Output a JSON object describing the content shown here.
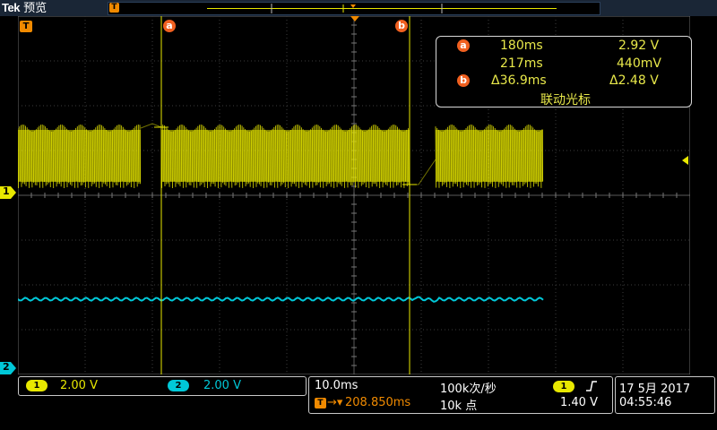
{
  "header": {
    "brand": "Tek",
    "mode": "预览"
  },
  "cursors": {
    "a_label": "a",
    "b_label": "b",
    "trigger_marker": "T"
  },
  "readout": {
    "a_time": "180ms",
    "a_volt": "2.92 V",
    "b_time": "217ms",
    "b_volt": "440mV",
    "delta_time": "Δ36.9ms",
    "delta_volt": "Δ2.48 V",
    "mode": "联动光标"
  },
  "channels": {
    "ch1": {
      "label": "1",
      "scale": "2.00 V",
      "color": "#e8e800"
    },
    "ch2": {
      "label": "2",
      "scale": "2.00 V",
      "color": "#00c8d8"
    }
  },
  "timebase": {
    "scale": "10.0ms",
    "sample_rate": "100k次/秒",
    "trigger_delay": "208.850ms",
    "record_length": "10k 点"
  },
  "trigger": {
    "source": "1",
    "slope_icon": "rising-edge-icon",
    "level": "1.40 V"
  },
  "datetime": {
    "date": "17 5月 2017",
    "time": "04:55:46"
  },
  "colors": {
    "ch1": "#e8e800",
    "ch2": "#00c8d8",
    "trigger": "#f08a00",
    "cursor": "#f06020"
  }
}
